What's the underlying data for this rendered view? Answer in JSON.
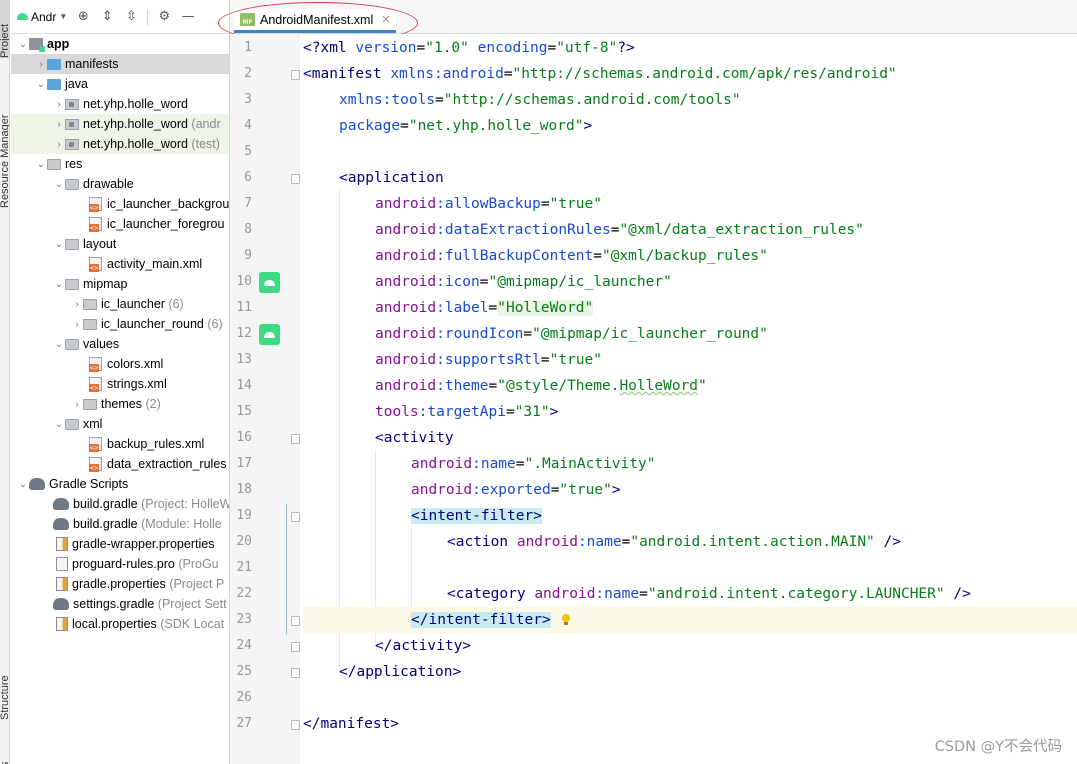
{
  "left_strip": {
    "tabs": [
      "Project",
      "Resource Manager",
      "Structure",
      "Fes"
    ]
  },
  "project_panel": {
    "view_selector": "Andr",
    "tree": [
      {
        "label": "app",
        "hint": "",
        "icon": "app-icon",
        "expanded": true
      },
      {
        "label": "manifests",
        "hint": "",
        "icon": "folder-icon",
        "expanded": false
      },
      {
        "label": "java",
        "hint": "",
        "icon": "folder-icon",
        "expanded": true
      },
      {
        "label": "net.yhp.holle_word",
        "hint": "",
        "icon": "package-icon",
        "expanded": false
      },
      {
        "label": "net.yhp.holle_word",
        "hint": "(andr",
        "icon": "package-icon",
        "expanded": false
      },
      {
        "label": "net.yhp.holle_word",
        "hint": "(test)",
        "icon": "package-icon",
        "expanded": false
      },
      {
        "label": "res",
        "hint": "",
        "icon": "folder-icon",
        "expanded": true
      },
      {
        "label": "drawable",
        "hint": "",
        "icon": "folder-icon",
        "expanded": true
      },
      {
        "label": "ic_launcher_backgrou",
        "hint": "",
        "icon": "xml-file-icon",
        "expanded": null
      },
      {
        "label": "ic_launcher_foregrou",
        "hint": "",
        "icon": "xml-file-icon",
        "expanded": null
      },
      {
        "label": "layout",
        "hint": "",
        "icon": "folder-icon",
        "expanded": true
      },
      {
        "label": "activity_main.xml",
        "hint": "",
        "icon": "xml-file-icon",
        "expanded": null
      },
      {
        "label": "mipmap",
        "hint": "",
        "icon": "folder-icon",
        "expanded": true
      },
      {
        "label": "ic_launcher",
        "hint": "(6)",
        "icon": "folder-icon",
        "expanded": false
      },
      {
        "label": "ic_launcher_round",
        "hint": "(6)",
        "icon": "folder-icon",
        "expanded": false
      },
      {
        "label": "values",
        "hint": "",
        "icon": "folder-icon",
        "expanded": true
      },
      {
        "label": "colors.xml",
        "hint": "",
        "icon": "xml-file-icon",
        "expanded": null
      },
      {
        "label": "strings.xml",
        "hint": "",
        "icon": "xml-file-icon",
        "expanded": null
      },
      {
        "label": "themes",
        "hint": "(2)",
        "icon": "folder-icon",
        "expanded": false
      },
      {
        "label": "xml",
        "hint": "",
        "icon": "folder-icon",
        "expanded": true
      },
      {
        "label": "backup_rules.xml",
        "hint": "",
        "icon": "xml-file-icon",
        "expanded": null
      },
      {
        "label": "data_extraction_rules",
        "hint": "",
        "icon": "xml-file-icon",
        "expanded": null
      },
      {
        "label": "Gradle Scripts",
        "hint": "",
        "icon": "gradle-icon",
        "expanded": true
      },
      {
        "label": "build.gradle",
        "hint": "(Project: HolleW",
        "icon": "gradle-icon",
        "expanded": null
      },
      {
        "label": "build.gradle",
        "hint": "(Module: Holle",
        "icon": "gradle-icon",
        "expanded": null
      },
      {
        "label": "gradle-wrapper.properties",
        "hint": "",
        "icon": "properties-icon",
        "expanded": null
      },
      {
        "label": "proguard-rules.pro",
        "hint": "(ProGu",
        "icon": "pro-file-icon",
        "expanded": null
      },
      {
        "label": "gradle.properties",
        "hint": "(Project P",
        "icon": "properties-icon",
        "expanded": null
      },
      {
        "label": "settings.gradle",
        "hint": "(Project Sett",
        "icon": "gradle-icon",
        "expanded": null
      },
      {
        "label": "local.properties",
        "hint": "(SDK Locat",
        "icon": "properties-icon",
        "expanded": null
      }
    ]
  },
  "editor_tab": {
    "title": "AndroidManifest.xml",
    "icon_text": "MF"
  },
  "editor": {
    "line_numbers": [
      "1",
      "2",
      "3",
      "4",
      "5",
      "6",
      "7",
      "8",
      "9",
      "10",
      "11",
      "12",
      "13",
      "14",
      "15",
      "16",
      "17",
      "18",
      "19",
      "20",
      "21",
      "22",
      "23",
      "24",
      "25",
      "26",
      "27"
    ],
    "code": {
      "l1": [
        "<?xml ",
        "version",
        "=",
        "\"1.0\"",
        " ",
        "encoding",
        "=",
        "\"utf-8\"",
        "?>"
      ],
      "l2": [
        "<manifest ",
        "xmlns:",
        "android",
        "=",
        "\"http://schemas.android.com/apk/res/android\""
      ],
      "l3": [
        "xmlns:",
        "tools",
        "=",
        "\"http://schemas.android.com/tools\""
      ],
      "l4": [
        "package",
        "=",
        "\"net.yhp.holle_word\"",
        ">"
      ],
      "l6": [
        "<application"
      ],
      "l7": [
        "android",
        ":allowBackup",
        "=",
        "\"true\""
      ],
      "l8": [
        "android",
        ":dataExtractionRules",
        "=",
        "\"@xml/data_extraction_rules\""
      ],
      "l9": [
        "android",
        ":fullBackupContent",
        "=",
        "\"@xml/backup_rules\""
      ],
      "l10": [
        "android",
        ":icon",
        "=",
        "\"@mipmap/ic_launcher\""
      ],
      "l11": [
        "android",
        ":label",
        "=",
        "\"HolleWord\""
      ],
      "l12": [
        "android",
        ":roundIcon",
        "=",
        "\"@mipmap/ic_launcher_round\""
      ],
      "l13": [
        "android",
        ":supportsRtl",
        "=",
        "\"true\""
      ],
      "l14": [
        "android",
        ":theme",
        "=",
        "\"@style/Theme.",
        "HolleWord",
        "\""
      ],
      "l15": [
        "tools",
        ":targetApi",
        "=",
        "\"31\"",
        ">"
      ],
      "l16": [
        "<activity"
      ],
      "l17": [
        "android",
        ":name",
        "=",
        "\".MainActivity\""
      ],
      "l18": [
        "android",
        ":exported",
        "=",
        "\"true\"",
        ">"
      ],
      "l19": [
        "<intent-filter>"
      ],
      "l20": [
        "<action ",
        "android",
        ":name",
        "=",
        "\"android.intent.action.MAIN\"",
        " />"
      ],
      "l22": [
        "<category ",
        "android",
        ":name",
        "=",
        "\"android.intent.category.LAUNCHER\"",
        " />"
      ],
      "l23": [
        "</intent-filter>"
      ],
      "l24": [
        "</activity>"
      ],
      "l25": [
        "</application>"
      ],
      "l27": [
        "</manifest>"
      ]
    }
  },
  "watermark": "CSDN @Y不会代码",
  "colors": {
    "accent": "#4083c9",
    "tag": "#000080",
    "namespace": "#871094",
    "attribute": "#174ad4",
    "value": "#067d17",
    "annotation": "#e03c3c"
  }
}
